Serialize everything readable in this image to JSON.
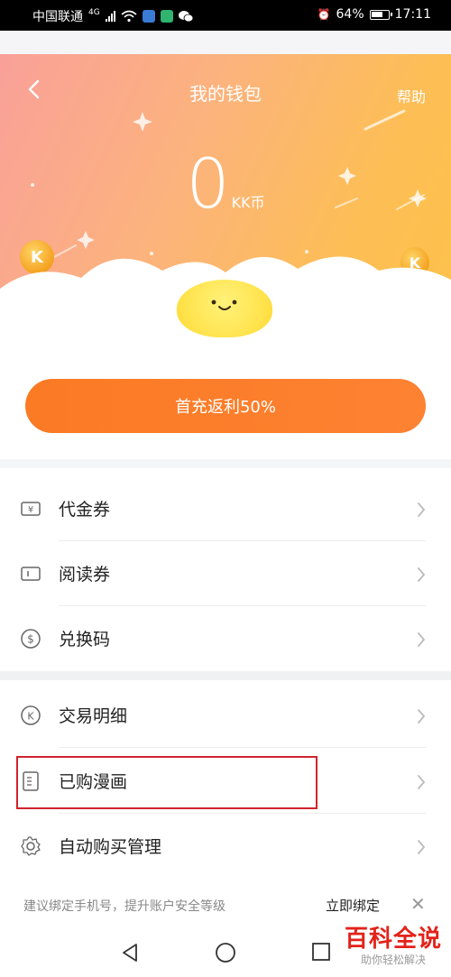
{
  "status_bar": {
    "carrier": "中国联通",
    "network": "4G",
    "alarm": "⏰",
    "battery": "64%",
    "time": "17:11"
  },
  "header": {
    "title": "我的钱包",
    "help": "帮助"
  },
  "balance": {
    "amount": "0",
    "unit": "KK币"
  },
  "recharge": {
    "label": "首充返利50%"
  },
  "sections": {
    "coupons": [
      {
        "icon": "yen-ticket-icon",
        "label": "代金券"
      },
      {
        "icon": "ticket-icon",
        "label": "阅读券"
      },
      {
        "icon": "dollar-coin-icon",
        "label": "兑换码"
      }
    ],
    "records": [
      {
        "icon": "k-coin-icon",
        "label": "交易明细"
      },
      {
        "icon": "document-icon",
        "label": "已购漫画"
      },
      {
        "icon": "gear-icon",
        "label": "自动购买管理"
      }
    ]
  },
  "bind_phone": {
    "tip": "建议绑定手机号，提升账户安全等级",
    "action": "立即绑定",
    "close": "✕"
  },
  "watermark": {
    "main": "百科全说",
    "sub": "助你轻松解决"
  },
  "colors": {
    "accent": "#fb7a24",
    "highlight_box": "#d0232e"
  }
}
